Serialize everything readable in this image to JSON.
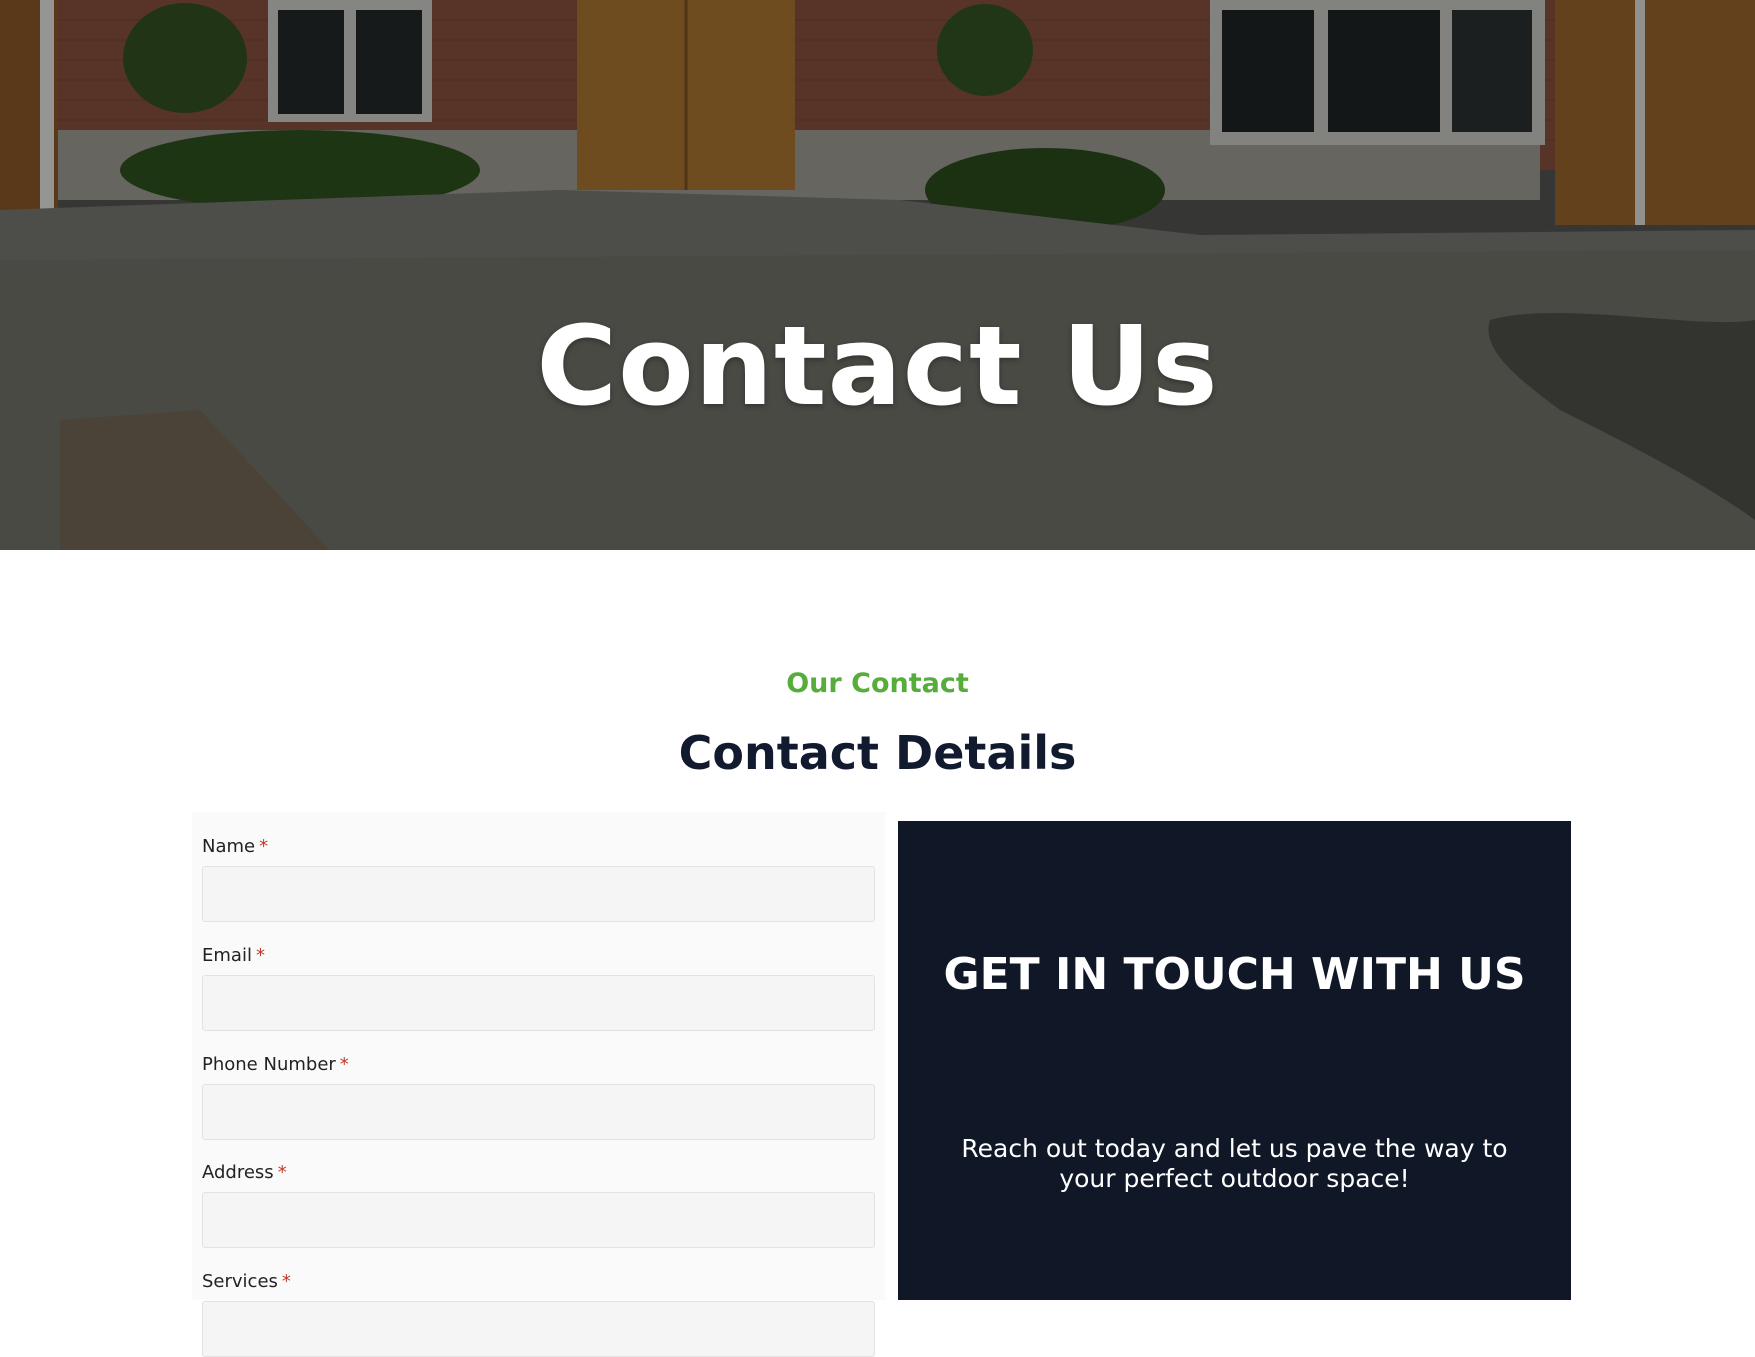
{
  "hero": {
    "title": "Contact Us"
  },
  "section": {
    "eyebrow": "Our Contact",
    "title": "Contact Details"
  },
  "form": {
    "required_mark": "*",
    "fields": [
      {
        "label": "Name",
        "value": ""
      },
      {
        "label": "Email",
        "value": ""
      },
      {
        "label": "Phone Number",
        "value": ""
      },
      {
        "label": "Address",
        "value": ""
      },
      {
        "label": "Services",
        "value": ""
      }
    ]
  },
  "cta": {
    "title": "GET IN TOUCH WITH US",
    "text": "Reach out today and let us pave the way to your perfect outdoor space!"
  },
  "colors": {
    "accent_green": "#56ad3b",
    "navy": "#101828",
    "required_red": "#c0392b"
  }
}
